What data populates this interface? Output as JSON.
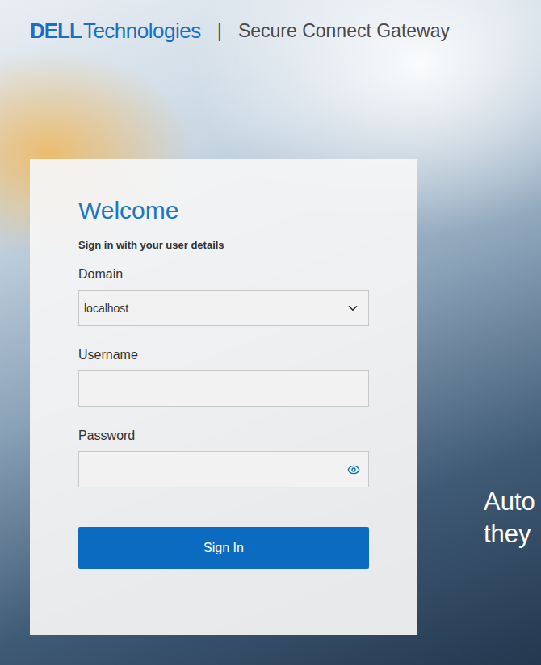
{
  "header": {
    "logo": "DELL",
    "brand": "Technologies",
    "separator": "|",
    "product": "Secure Connect Gateway"
  },
  "form": {
    "title": "Welcome",
    "subtitle": "Sign in with your user details",
    "fields": [
      {
        "kind": "select",
        "label": "Domain",
        "value": "localhost"
      },
      {
        "kind": "text",
        "label": "Username",
        "value": ""
      },
      {
        "kind": "password",
        "label": "Password",
        "value": ""
      }
    ],
    "submit": "Sign In"
  },
  "tagline": [
    "Auto",
    "they"
  ]
}
